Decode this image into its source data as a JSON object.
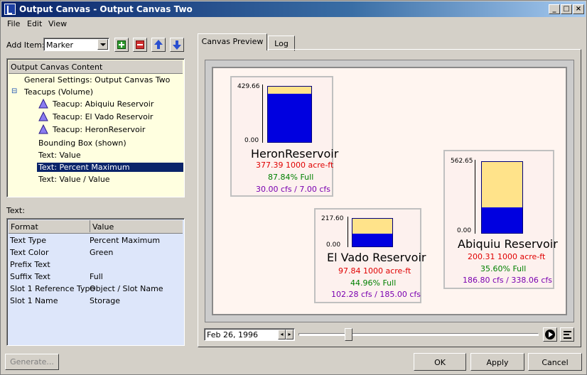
{
  "window": {
    "title": "Output Canvas - Output Canvas Two",
    "min": "_",
    "max": "□",
    "close": "×"
  },
  "menu": [
    "File",
    "Edit",
    "View"
  ],
  "add_item": {
    "label": "Add Item:",
    "value": "Marker"
  },
  "tree": {
    "header": "Output Canvas Content",
    "rows": [
      "General Settings: Output Canvas Two",
      "Teacups (Volume)",
      "Teacup: Abiquiu Reservoir",
      "Teacup: El Vado Reservoir",
      "Teacup: HeronReservoir",
      "Bounding Box (shown)",
      "Text: Value",
      "Text: Percent Maximum",
      "Text: Value / Value"
    ],
    "expander": "⊟"
  },
  "props": {
    "label": "Text:",
    "columns": [
      "Format",
      "Value"
    ],
    "rows": [
      [
        "Text Type",
        "Percent Maximum"
      ],
      [
        "Text Color",
        "Green"
      ],
      [
        "Prefix Text",
        ""
      ],
      [
        "Suffix Text",
        "Full"
      ],
      [
        "Slot 1 Reference Type",
        "Object / Slot Name"
      ],
      [
        "Slot 1 Name",
        "Storage"
      ]
    ]
  },
  "generate_label": "Generate...",
  "tabs": [
    "Canvas Preview",
    "Log"
  ],
  "teacups": [
    {
      "name": "HeronReservoir",
      "max": "429.66",
      "min": "0.00",
      "fraction": 0.8784,
      "line1": "377.39 1000 acre-ft",
      "line2": "87.84% Full",
      "line3": "30.00 cfs / 7.00 cfs"
    },
    {
      "name": "El Vado Reservoir",
      "max": "217.60",
      "min": "0.00",
      "fraction": 0.4496,
      "line1": "97.84 1000 acre-ft",
      "line2": "44.96% Full",
      "line3": "102.28 cfs / 185.00 cfs"
    },
    {
      "name": "Abiquiu Reservoir",
      "max": "562.65",
      "min": "0.00",
      "fraction": 0.356,
      "line1": "200.31 1000 acre-ft",
      "line2": "35.60% Full",
      "line3": "186.80 cfs / 338.06 cfs"
    }
  ],
  "date": "Feb 26, 1996",
  "timeline_position": 0.2,
  "buttons": {
    "ok": "OK",
    "apply": "Apply",
    "cancel": "Cancel"
  },
  "colors": {
    "fill": "#0000e0",
    "capacity": "#ffe38a",
    "selection": "#0a246a"
  }
}
